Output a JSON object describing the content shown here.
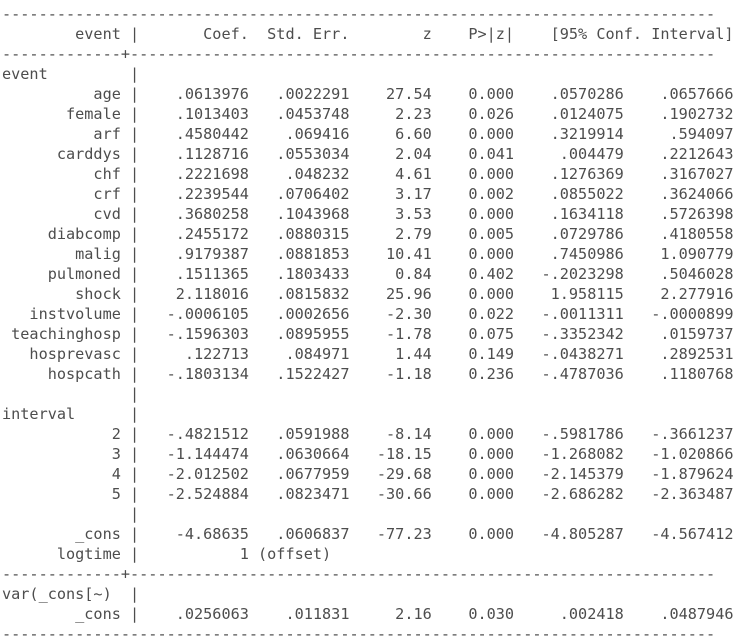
{
  "table": {
    "name": "stata-regression-output",
    "rule_char": "-",
    "rule_width": 78,
    "pipe_column": 13,
    "header": {
      "stub_label": "event",
      "columns": [
        "Coef.",
        "Std. Err.",
        "z",
        "P>|z|",
        "[95% Conf. Interval]"
      ]
    },
    "column_widths": {
      "stub": 13,
      "coef": 12,
      "stderr": 11,
      "z": 9,
      "p": 9,
      "ci_low": 12,
      "ci_high": 12
    },
    "sections": [
      {
        "title": "event",
        "rows": [
          {
            "label": "age",
            "coef": ".0613976",
            "stderr": ".0022291",
            "z": "27.54",
            "p": "0.000",
            "ci_low": ".0570286",
            "ci_high": ".0657666"
          },
          {
            "label": "female",
            "coef": ".1013403",
            "stderr": ".0453748",
            "z": "2.23",
            "p": "0.026",
            "ci_low": ".0124075",
            "ci_high": ".1902732"
          },
          {
            "label": "arf",
            "coef": ".4580442",
            "stderr": ".069416",
            "z": "6.60",
            "p": "0.000",
            "ci_low": ".3219914",
            "ci_high": ".594097"
          },
          {
            "label": "carddys",
            "coef": ".1128716",
            "stderr": ".0553034",
            "z": "2.04",
            "p": "0.041",
            "ci_low": ".004479",
            "ci_high": ".2212643"
          },
          {
            "label": "chf",
            "coef": ".2221698",
            "stderr": ".048232",
            "z": "4.61",
            "p": "0.000",
            "ci_low": ".1276369",
            "ci_high": ".3167027"
          },
          {
            "label": "crf",
            "coef": ".2239544",
            "stderr": ".0706402",
            "z": "3.17",
            "p": "0.002",
            "ci_low": ".0855022",
            "ci_high": ".3624066"
          },
          {
            "label": "cvd",
            "coef": ".3680258",
            "stderr": ".1043968",
            "z": "3.53",
            "p": "0.000",
            "ci_low": ".1634118",
            "ci_high": ".5726398"
          },
          {
            "label": "diabcomp",
            "coef": ".2455172",
            "stderr": ".0880315",
            "z": "2.79",
            "p": "0.005",
            "ci_low": ".0729786",
            "ci_high": ".4180558"
          },
          {
            "label": "malig",
            "coef": ".9179387",
            "stderr": ".0881853",
            "z": "10.41",
            "p": "0.000",
            "ci_low": ".7450986",
            "ci_high": "1.090779"
          },
          {
            "label": "pulmoned",
            "coef": ".1511365",
            "stderr": ".1803433",
            "z": "0.84",
            "p": "0.402",
            "ci_low": "-.2023298",
            "ci_high": ".5046028"
          },
          {
            "label": "shock",
            "coef": "2.118016",
            "stderr": ".0815832",
            "z": "25.96",
            "p": "0.000",
            "ci_low": "1.958115",
            "ci_high": "2.277916"
          },
          {
            "label": "instvolume",
            "coef": "-.0006105",
            "stderr": ".0002656",
            "z": "-2.30",
            "p": "0.022",
            "ci_low": "-.0011311",
            "ci_high": "-.0000899"
          },
          {
            "label": "teachinghosp",
            "coef": "-.1596303",
            "stderr": ".0895955",
            "z": "-1.78",
            "p": "0.075",
            "ci_low": "-.3352342",
            "ci_high": ".0159737"
          },
          {
            "label": "hosprevasc",
            "coef": ".122713",
            "stderr": ".084971",
            "z": "1.44",
            "p": "0.149",
            "ci_low": "-.0438271",
            "ci_high": ".2892531"
          },
          {
            "label": "hospcath",
            "coef": "-.1803134",
            "stderr": ".1522427",
            "z": "-1.18",
            "p": "0.236",
            "ci_low": "-.4787036",
            "ci_high": ".1180768"
          }
        ]
      },
      {
        "title": "interval",
        "rows": [
          {
            "label": "2",
            "coef": "-.4821512",
            "stderr": ".0591988",
            "z": "-8.14",
            "p": "0.000",
            "ci_low": "-.5981786",
            "ci_high": "-.3661237"
          },
          {
            "label": "3",
            "coef": "-1.144474",
            "stderr": ".0630664",
            "z": "-18.15",
            "p": "0.000",
            "ci_low": "-1.268082",
            "ci_high": "-1.020866"
          },
          {
            "label": "4",
            "coef": "-2.012502",
            "stderr": ".0677959",
            "z": "-29.68",
            "p": "0.000",
            "ci_low": "-2.145379",
            "ci_high": "-1.879624"
          },
          {
            "label": "5",
            "coef": "-2.524884",
            "stderr": ".0823471",
            "z": "-30.66",
            "p": "0.000",
            "ci_low": "-2.686282",
            "ci_high": "-2.363487"
          }
        ]
      },
      {
        "title": "",
        "rows": [
          {
            "label": "_cons",
            "coef": "-4.68635",
            "stderr": ".0606837",
            "z": "-77.23",
            "p": "0.000",
            "ci_low": "-4.805287",
            "ci_high": "-4.567412"
          },
          {
            "label": "logtime",
            "coef": "1",
            "stderr": "(offset)",
            "z": "",
            "p": "",
            "ci_low": "",
            "ci_high": "",
            "stderr_align": "left"
          }
        ]
      }
    ],
    "variance_section": {
      "title": "var(_cons[~)",
      "rows": [
        {
          "label": "_cons",
          "coef": ".0256063",
          "stderr": ".011831",
          "z": "2.16",
          "p": "0.030",
          "ci_low": ".002418",
          "ci_high": ".0487946"
        }
      ]
    }
  },
  "colors": {
    "text": "#4d4d4d",
    "background": "#ffffff"
  }
}
